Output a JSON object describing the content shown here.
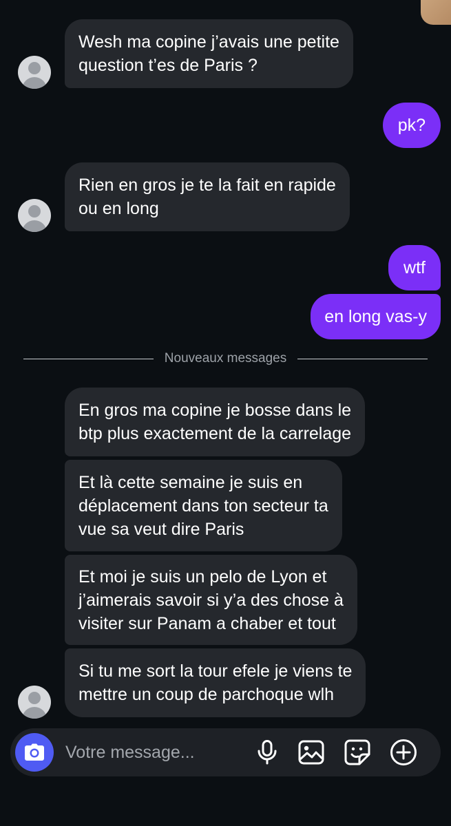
{
  "messages": [
    {
      "text_lines": [
        "Wesh ma copine j’avais une petite",
        "question t’es de Paris ?"
      ]
    },
    {
      "text_lines": [
        "pk?"
      ]
    },
    {
      "text_lines": [
        "Rien en gros je te la fait en rapide",
        "ou en long"
      ]
    },
    {
      "text_lines": [
        "wtf"
      ]
    },
    {
      "text_lines": [
        "en long vas-y"
      ]
    },
    {
      "text_lines": [
        "En gros ma copine je bosse dans le",
        "btp plus exactement de la carrelage"
      ]
    },
    {
      "text_lines": [
        "Et là cette semaine je suis en",
        "déplacement dans ton secteur ta",
        "vue sa veut dire Paris"
      ]
    },
    {
      "text_lines": [
        "Et moi je suis un pelo de Lyon et",
        "j’aimerais savoir si y’a des chose à",
        "visiter sur Panam a chaber et tout"
      ]
    },
    {
      "text_lines": [
        "Si tu me sort la tour efele je viens te",
        "mettre un coup de parchoque wlh"
      ]
    }
  ],
  "divider": {
    "label": "Nouveaux messages"
  },
  "composer": {
    "placeholder": "Votre message...",
    "icons": [
      "camera-icon",
      "microphone-icon",
      "image-icon",
      "sticker-icon",
      "plus-circle-icon"
    ]
  },
  "colors": {
    "background": "#0b0f13",
    "incoming_bubble": "#25282d",
    "outgoing_bubble": "#7b2ff7",
    "camera_button": "#4f5bf3"
  }
}
